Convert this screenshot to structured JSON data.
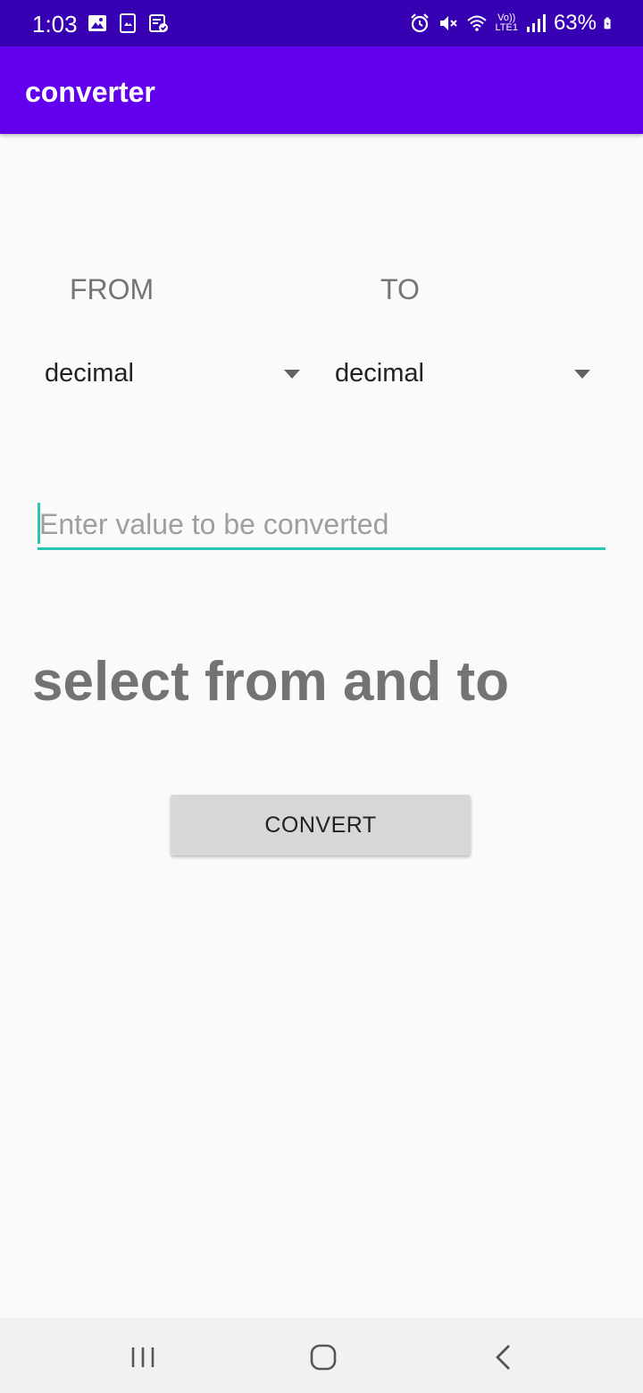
{
  "status_bar": {
    "time": "1:03",
    "battery_percent": "63%",
    "left_icons": [
      "gallery-icon",
      "photo-sync-icon",
      "task-check-icon"
    ],
    "right_icons": [
      "alarm-icon",
      "mute-icon",
      "wifi-icon",
      "volte-icon",
      "signal-icon",
      "battery-icon"
    ],
    "volte_text": "LTE1",
    "colors": {
      "background": "#3700b3",
      "foreground": "#ffffff"
    }
  },
  "app_bar": {
    "title": "converter",
    "color": "#6200ee"
  },
  "labels": {
    "from": "FROM",
    "to": "TO"
  },
  "spinners": {
    "from_selected": "decimal",
    "to_selected": "decimal"
  },
  "input": {
    "value": "",
    "placeholder": "Enter value to be converted",
    "accent_color": "#26c6b4"
  },
  "result_text": "select from and to",
  "convert_button": {
    "label": "CONVERT"
  },
  "nav_bar": {
    "icons": [
      "recents-icon",
      "home-icon",
      "back-icon"
    ]
  }
}
